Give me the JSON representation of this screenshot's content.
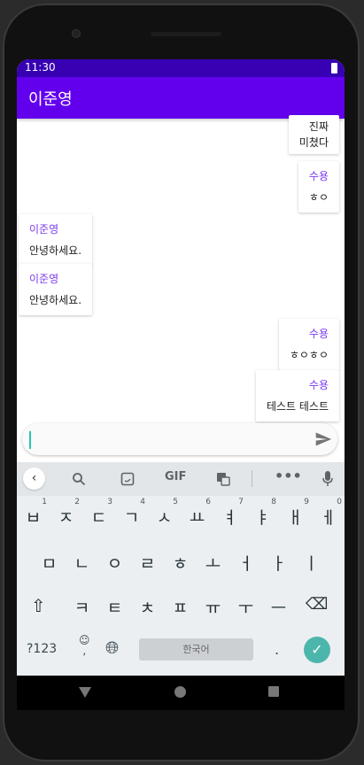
{
  "status": {
    "time": "11:30"
  },
  "app": {
    "title": "이준영"
  },
  "messages": [
    {
      "side": "right",
      "name": "",
      "text": "진짜\n미쳤다"
    },
    {
      "side": "right",
      "name": "수용",
      "text": "ㅎㅇ"
    },
    {
      "side": "left",
      "name": "이준영",
      "text": "안녕하세요."
    },
    {
      "side": "left",
      "name": "이준영",
      "text": "안녕하세요."
    },
    {
      "side": "right",
      "name": "수용",
      "text": "ㅎㅇㅎㅇ"
    },
    {
      "side": "right",
      "name": "수용",
      "text": "테스트 테스트"
    }
  ],
  "input": {
    "value": ""
  },
  "keyboard": {
    "toolbar": {
      "gif": "GIF"
    },
    "row1": [
      "ㅂ",
      "ㅈ",
      "ㄷ",
      "ㄱ",
      "ㅅ",
      "ㅛ",
      "ㅕ",
      "ㅑ",
      "ㅐ",
      "ㅔ"
    ],
    "row1_hints": [
      "1",
      "2",
      "3",
      "4",
      "5",
      "6",
      "7",
      "8",
      "9",
      "0"
    ],
    "row2": [
      "ㅁ",
      "ㄴ",
      "ㅇ",
      "ㄹ",
      "ㅎ",
      "ㅗ",
      "ㅓ",
      "ㅏ",
      "ㅣ"
    ],
    "row3": [
      "ㅋ",
      "ㅌ",
      "ㅊ",
      "ㅍ",
      "ㅠ",
      "ㅜ",
      "ㅡ"
    ],
    "symbols": "?123",
    "comma": ",",
    "space": "한국어",
    "period": "."
  },
  "colors": {
    "status_bar": "#3700b3",
    "app_bar": "#6200ee",
    "name": "#7c3aed",
    "enter": "#4db6ac"
  }
}
